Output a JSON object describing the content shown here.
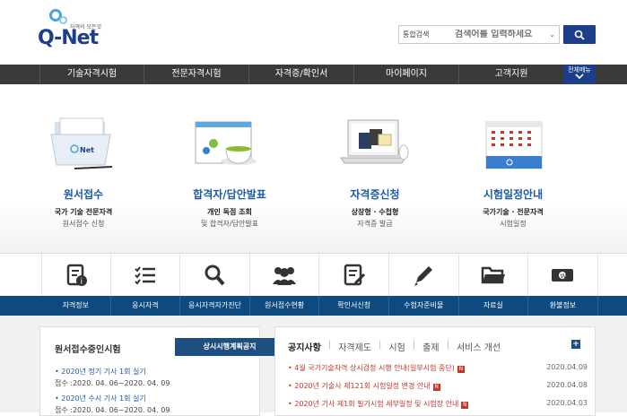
{
  "logo": {
    "name": "Q-Net",
    "slogan": "자격의 모든것"
  },
  "search": {
    "scope": "통합검색",
    "placeholder": "검색어를 입력하세요"
  },
  "gnb": {
    "items": [
      "기술자격시험",
      "전문자격시험",
      "자격증/확인서",
      "마이페이지",
      "고객지원"
    ],
    "all_menu": "전체메뉴"
  },
  "services": [
    {
      "title": "원서접수",
      "sub1": "국가 기술 전문자격",
      "sub2": "원서접수 신청"
    },
    {
      "title": "합격자/답안발표",
      "sub1": "개인 독점 조회",
      "sub2": "및 합격자/답안발표"
    },
    {
      "title": "자격증신청",
      "sub1": "상장형 · 수첩형",
      "sub2": "자격증 발급"
    },
    {
      "title": "시험일정안내",
      "sub1": "국가기술 · 전문자격",
      "sub2": "시험일정"
    }
  ],
  "quick": [
    "자격정보",
    "응시자격",
    "응시자격자가진단",
    "원서접수현황",
    "확인서신청",
    "수험자준비물",
    "자료실",
    "환불정보"
  ],
  "exam_box": {
    "title": "원서접수중인시험",
    "button": "상시시행계획공지",
    "items": [
      {
        "name": "• 2020년 정기 기사 1회 실기",
        "period": "접수 :2020. 04. 06~2020. 04. 09"
      },
      {
        "name": "• 2020년 수시 기사 1회 실기",
        "period": "접수 :2020. 04. 06~2020. 04. 09"
      }
    ]
  },
  "notice": {
    "tabs": [
      "공지사항",
      "자격제도",
      "시험",
      "출제",
      "서비스 개선"
    ],
    "plus": "+",
    "items": [
      {
        "title": "• 4월 국가기술자격 상시검정 시행 안내(일부시험 중단)",
        "badge": "N",
        "date": "2020.04.09"
      },
      {
        "title": "• 2020년 기술사 제121회 시험일정 변경 안내",
        "badge": "N",
        "date": "2020.04.08"
      },
      {
        "title": "• 2020년 기사 제1회 필기시험 세부일정 및 시험장 안내",
        "badge": "N",
        "date": "2020.04.03"
      }
    ]
  },
  "colors": {
    "brand": "#1d3f8a",
    "nav": "#3a3a3a",
    "quickbar": "#0f4a7e",
    "accent": "#1d5aa7",
    "notice": "#c0392b"
  }
}
